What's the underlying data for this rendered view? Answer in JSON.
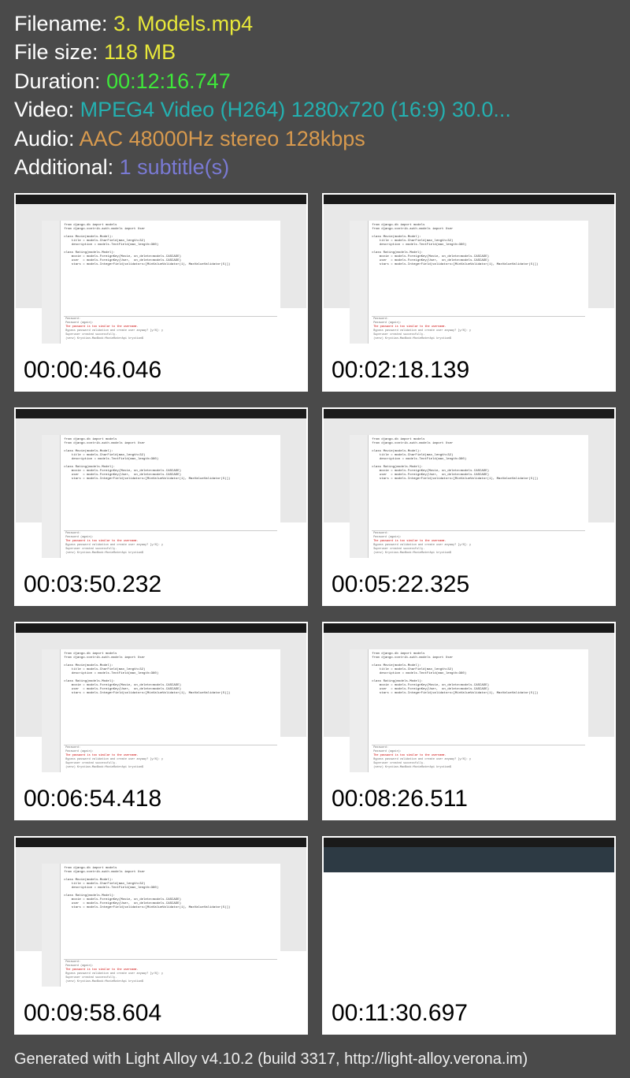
{
  "meta": {
    "filename_label": "Filename: ",
    "filename_value": "3. Models.mp4",
    "filesize_label": "File size: ",
    "filesize_value": "118 MB",
    "duration_label": "Duration: ",
    "duration_value": "00:12:16.747",
    "video_label": "Video: ",
    "video_value": "MPEG4 Video (H264) 1280x720 (16:9) 30.0...",
    "audio_label": "Audio: ",
    "audio_value": "AAC 48000Hz stereo 128kbps",
    "additional_label": "Additional: ",
    "additional_value": "1 subtitle(s)"
  },
  "thumbnails": [
    {
      "time": "00:00:46.046",
      "kind": "code"
    },
    {
      "time": "00:02:18.139",
      "kind": "code"
    },
    {
      "time": "00:03:50.232",
      "kind": "code"
    },
    {
      "time": "00:05:22.325",
      "kind": "code"
    },
    {
      "time": "00:06:54.418",
      "kind": "code"
    },
    {
      "time": "00:08:26.511",
      "kind": "code"
    },
    {
      "time": "00:09:58.604",
      "kind": "code"
    },
    {
      "time": "00:11:30.697",
      "kind": "web"
    }
  ],
  "codesnip": "from django.db import models\nfrom django.contrib.auth.models import User\n\nclass Movie(models.Model):\n    title = models.CharField(max_length=32)\n    description = models.TextField(max_length=360)\n\nclass Rating(models.Model):\n    movie = models.ForeignKey(Movie, on_delete=models.CASCADE)\n    user  = models.ForeignKey(User,  on_delete=models.CASCADE)\n    stars = models.IntegerField(validators=[MinValueValidator(1), MaxValueValidator(5)])",
  "termsnip_line1": "Password:",
  "termsnip_line2": "Password (again):",
  "termsnip_err": "The password is too similar to the username.",
  "termsnip_line3": "Bypass password validation and create user anyway? [y/N]: y",
  "termsnip_line4": "Superuser created successfully.",
  "termsnip_line5": "(venv) Krystian-MacBook:MovieRaterApi krystian$",
  "footer": "Generated with Light Alloy v4.10.2 (build 3317, http://light-alloy.verona.im)"
}
